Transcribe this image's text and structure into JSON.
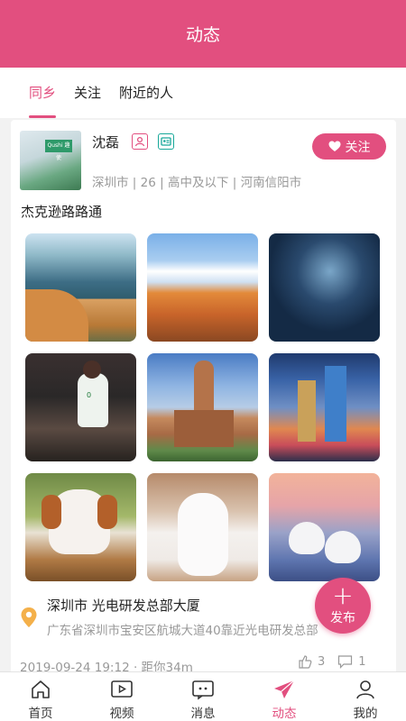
{
  "header": {
    "title": "动态"
  },
  "tabs": [
    {
      "label": "同乡",
      "active": true
    },
    {
      "label": "关注",
      "active": false
    },
    {
      "label": "附近的人",
      "active": false
    }
  ],
  "post": {
    "user": {
      "name": "沈磊",
      "meta": "深圳市 | 26 | 高中及以下 | 河南信阳市",
      "avatar_sign": "Qushi 趣使"
    },
    "follow_label": "关注",
    "text": "杰克逊路路通",
    "location": {
      "title": "深圳市 光电研发总部大厦",
      "address": "广东省深圳市宝安区航城大道40靠近光电研发总部"
    },
    "footer": {
      "time_distance": "2019-09-24 19:12 · 距你34m",
      "likes": "3",
      "comments": "1"
    }
  },
  "fab": {
    "label": "发布",
    "plus": "+"
  },
  "bottom_nav": [
    {
      "label": "首页",
      "icon": "home-icon",
      "active": false
    },
    {
      "label": "视频",
      "icon": "video-icon",
      "active": false
    },
    {
      "label": "消息",
      "icon": "message-icon",
      "active": false
    },
    {
      "label": "动态",
      "icon": "send-icon",
      "active": true
    },
    {
      "label": "我的",
      "icon": "user-icon",
      "active": false
    }
  ],
  "colors": {
    "accent": "#e24f7f",
    "teal": "#18a89a"
  }
}
